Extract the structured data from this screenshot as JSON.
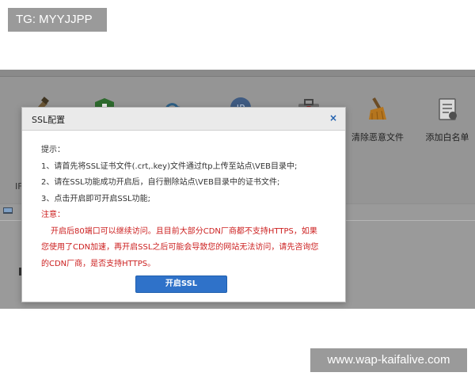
{
  "overlay": {
    "tg_label": "TG: MYYJJPP",
    "watermark": "www.wap-kaifalive.com"
  },
  "toolbar": {
    "items": [
      {
        "icon": "brush-icon",
        "label": ""
      },
      {
        "icon": "shield-icon",
        "label": ""
      },
      {
        "icon": "cloud-icon",
        "label": ""
      },
      {
        "icon": "ip-icon",
        "label": ""
      },
      {
        "icon": "first-aid-kit-icon",
        "label": ""
      },
      {
        "icon": "broom-icon",
        "label": "清除恶意文件"
      },
      {
        "icon": "whitelist-icon",
        "label": "添加白名单"
      }
    ],
    "side_fragment": "IF"
  },
  "dialog": {
    "title": "SSL配置",
    "close_glyph": "×",
    "tip_label": "提示：",
    "steps": [
      "1、请首先将SSL证书文件(.crt,.key)文件通过ftp上传至站点\\VEB目录中;",
      "2、请在SSL功能成功开启后，自行删除站点\\VEB目录中的证书文件;",
      "3、点击开启即可开启SSL功能;"
    ],
    "notice_label": "注意：",
    "warning_lines": [
      "开启后80端口可以继续访问。且目前大部分CDN厂商都不支持HTTPS，如果",
      "您使用了CDN加速，再开启SSL之后可能会导致您的网站无法访问，请先咨询您",
      "的CDN厂商，是否支持HTTPS。"
    ],
    "enable_button": "开启SSL"
  }
}
